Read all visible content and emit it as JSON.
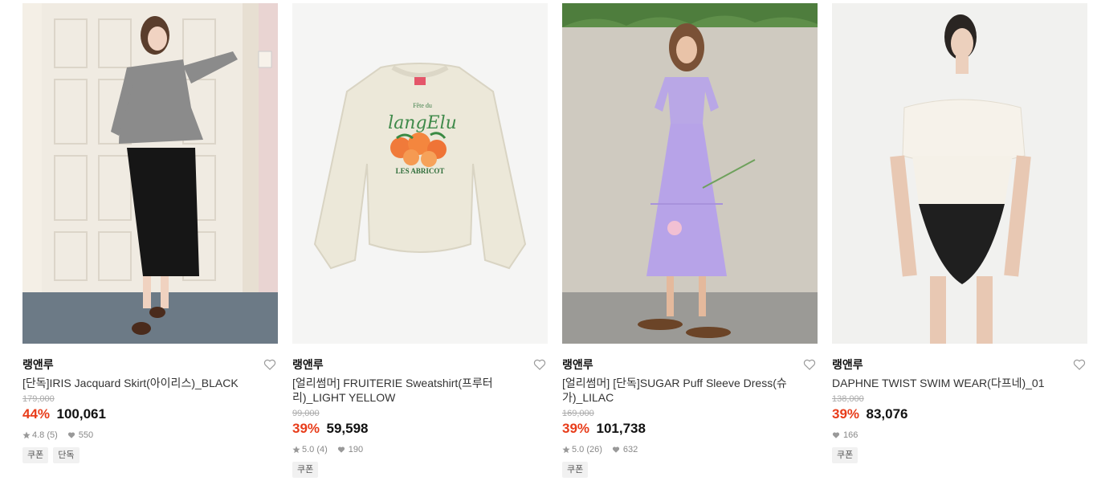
{
  "products": [
    {
      "brand": "랭앤루",
      "title": "[단독]IRIS Jacquard Skirt(아이리스)_BLACK",
      "original_price": "179,000",
      "discount": "44%",
      "price": "100,061",
      "rating": "4.8 (5)",
      "likes": "550",
      "tags": [
        "쿠폰",
        "단독"
      ],
      "image": "model-black-skirt-grey-cardigan"
    },
    {
      "brand": "랭앤루",
      "title": "[얼리썸머] FRUITERIE Sweatshirt(프루터리)_LIGHT YELLOW",
      "original_price": "99,000",
      "discount": "39%",
      "price": "59,598",
      "rating": "5.0 (4)",
      "likes": "190",
      "tags": [
        "쿠폰"
      ],
      "image": "cream-sweatshirt-apricot-print",
      "print_text": [
        "Fête du",
        "langElu",
        "LES ABRICOT"
      ]
    },
    {
      "brand": "랭앤루",
      "title": "[얼리썸머] [단독]SUGAR Puff Sleeve Dress(슈가)_LILAC",
      "original_price": "169,000",
      "discount": "39%",
      "price": "101,738",
      "rating": "5.0 (26)",
      "likes": "632",
      "tags": [
        "쿠폰"
      ],
      "image": "model-lilac-dress"
    },
    {
      "brand": "랭앤루",
      "title": "DAPHNE TWIST SWIM WEAR(다프네)_01",
      "original_price": "138,000",
      "discount": "39%",
      "price": "83,076",
      "rating": "",
      "likes": "166",
      "tags": [
        "쿠폰"
      ],
      "image": "model-white-black-swimwear"
    }
  ],
  "colors": {
    "discount": "#e83c1a",
    "heart": "#999999",
    "tag_bg": "#f1f1f1"
  },
  "icons": {
    "wishlist": "heart-outline-icon",
    "rating": "star-icon",
    "likes": "heart-filled-icon"
  }
}
